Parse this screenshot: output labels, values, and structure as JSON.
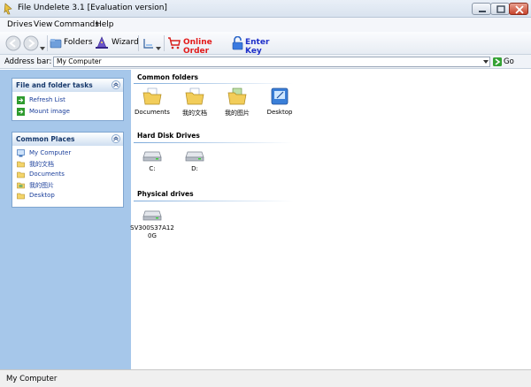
{
  "window": {
    "title": "File Undelete 3.1 [Evaluation version]"
  },
  "menu": {
    "items": [
      "Drives",
      "View",
      "Commands",
      "Help"
    ]
  },
  "toolbar": {
    "back_icon": "back-arrow-icon",
    "forward_icon": "forward-arrow-icon",
    "folders_label": "Folders",
    "wizard_label": "Wizard",
    "order_label": "Online Order",
    "enter_key_label": "Enter Key",
    "order_color": "#e21b1b",
    "enter_key_color": "#1d2fc9"
  },
  "address": {
    "label": "Address bar:",
    "value": "My Computer",
    "go_label": "Go"
  },
  "left": {
    "tasks": {
      "title": "File and folder tasks",
      "links": [
        "Refresh List",
        "Mount image"
      ]
    },
    "places": {
      "title": "Common Places",
      "links": [
        "My Computer",
        "我的文档",
        "Documents",
        "我的图片",
        "Desktop"
      ]
    }
  },
  "main": {
    "common_folders": {
      "title": "Common folders",
      "items": [
        "Documents",
        "我的文档",
        "我的图片",
        "Desktop"
      ]
    },
    "hard_disks": {
      "title": "Hard Disk Drives",
      "items": [
        "C:",
        "D:"
      ]
    },
    "physical": {
      "title": "Physical drives",
      "items": [
        "SV300S37A120G"
      ]
    }
  },
  "status": {
    "text": "My Computer"
  }
}
